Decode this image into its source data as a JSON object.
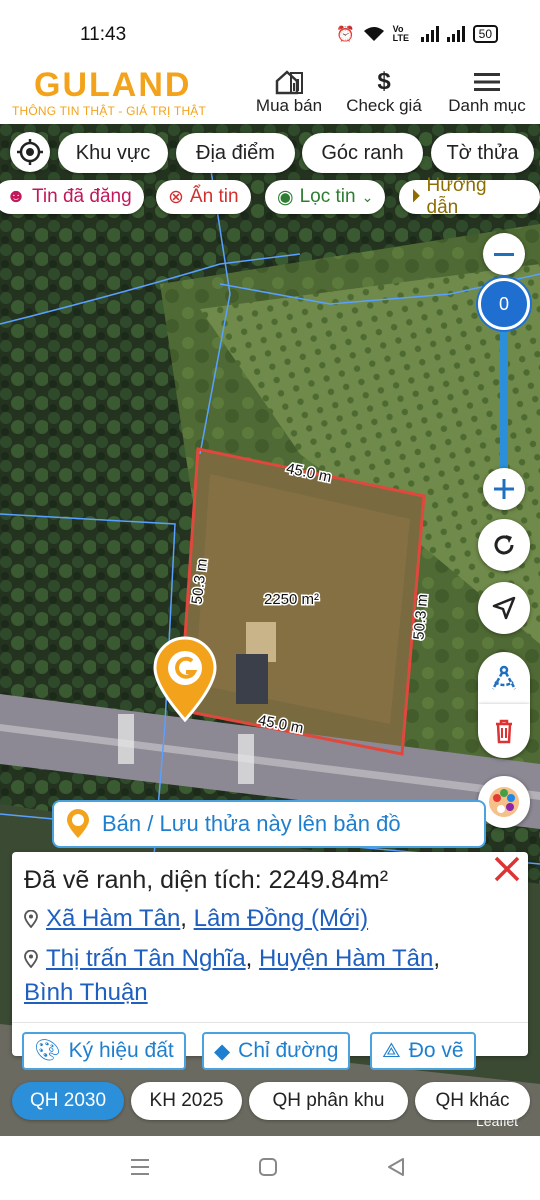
{
  "status": {
    "time": "11:43",
    "net": "Vo LTE",
    "battery": "50"
  },
  "header": {
    "logo": "GULAND",
    "tagline": "THÔNG TIN THẬT - GIÁ TRỊ THẬT",
    "nav": [
      {
        "label": "Mua bán",
        "icon": "house-chart-icon"
      },
      {
        "label": "Check giá",
        "icon": "dollar-icon"
      },
      {
        "label": "Danh mục",
        "icon": "menu-icon"
      }
    ]
  },
  "toolbar": {
    "tabs": [
      "Khu vực",
      "Địa điểm",
      "Góc ranh",
      "Tờ thửa"
    ]
  },
  "filters": {
    "posted": "Tin đã đăng",
    "hide": "Ẩn tin",
    "filter": "Lọc tin",
    "guide": "Hướng dẫn"
  },
  "zoom": {
    "level": "0"
  },
  "map": {
    "edges": {
      "top": "45.0 m",
      "bottom": "45.0 m",
      "left": "50.3 m",
      "right": "50.3 m"
    },
    "area_label": "2250 m²",
    "attribution": "Leaflet",
    "parcel_color": "#e0483e"
  },
  "save_bar": {
    "label": "Bán / Lưu thửa này lên bản đồ"
  },
  "info": {
    "title": "Đã vẽ ranh, diện tích: 2249.84m²",
    "new_addr": {
      "ward": "Xã Hàm Tân",
      "province": "Lâm Đồng (Mới)"
    },
    "old_addr": {
      "town": "Thị trấn Tân Nghĩa",
      "district": "Huyện Hàm Tân",
      "province": "Bình Thuận"
    },
    "actions": [
      "Ký hiệu đất",
      "Chỉ đường",
      "Đo vẽ"
    ]
  },
  "planning_tabs": [
    "QH 2030",
    "KH 2025",
    "QH phân khu",
    "QH khác"
  ],
  "colors": {
    "brand": "#f3a31b",
    "accent": "#1f7fcf",
    "active_tab": "#2b8fd9",
    "posted": "#c2185b",
    "hide": "#d32f2f",
    "filter": "#2e7d32",
    "guide": "#8d6e00"
  }
}
